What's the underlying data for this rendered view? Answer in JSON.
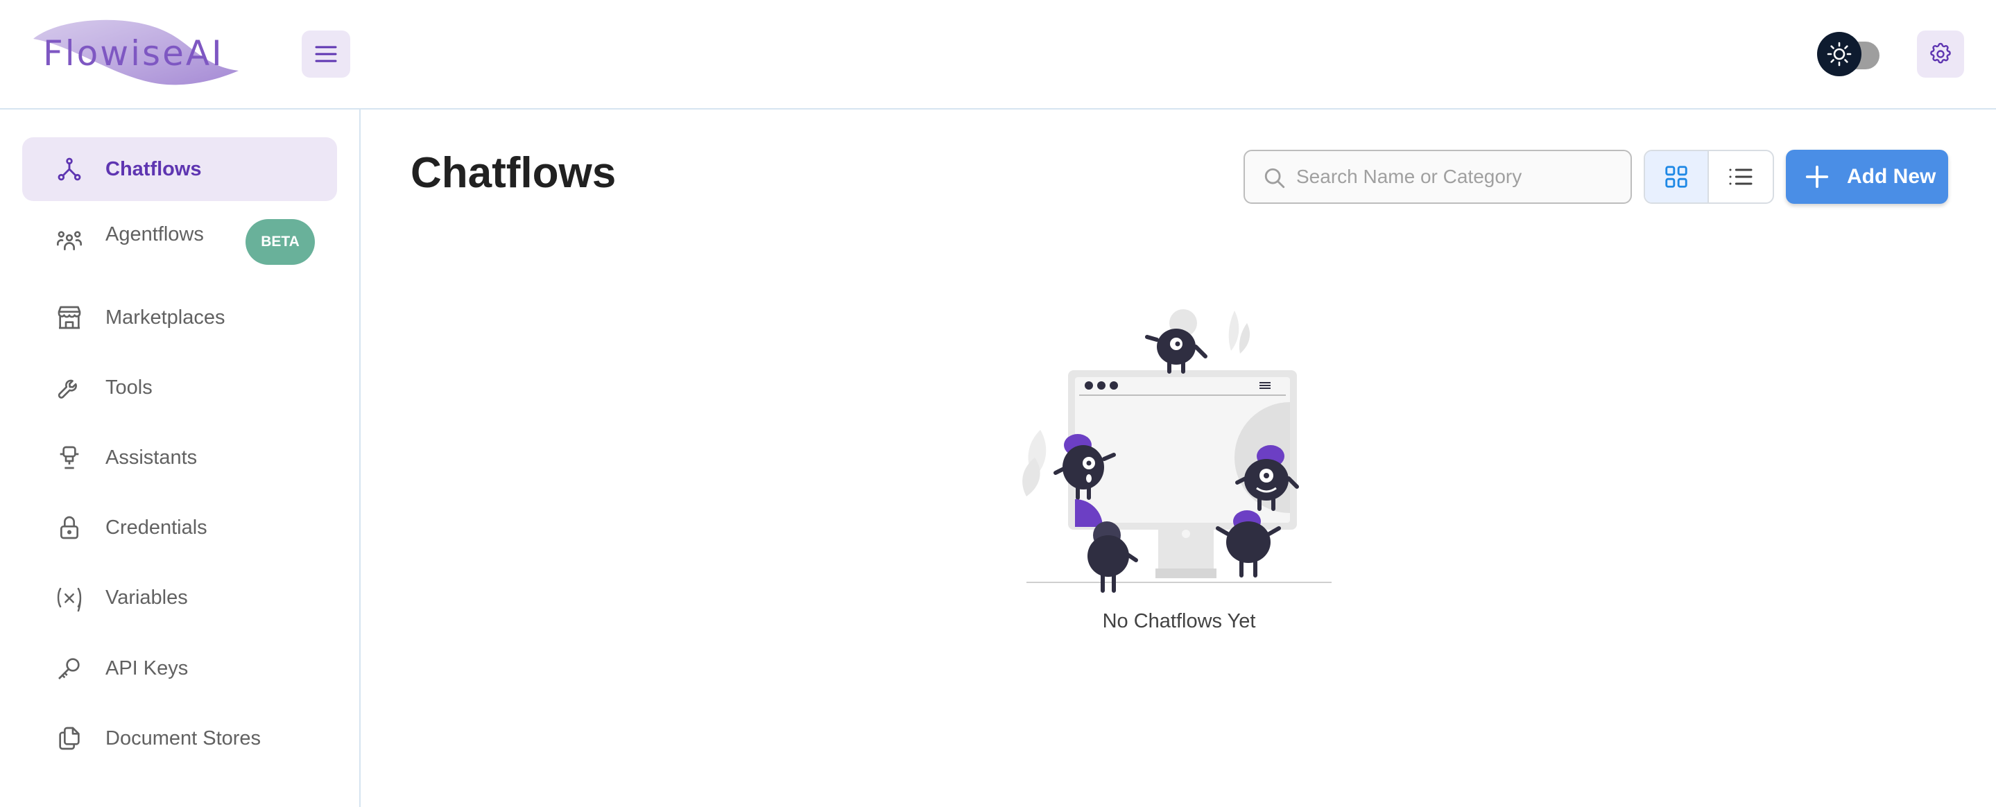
{
  "header": {
    "logo_text": "FlowiseAI",
    "colors": {
      "brand": "#7e57c2",
      "toggle_knob": "#0e1b2f",
      "icon_button_bg": "#ede7f6"
    },
    "icons": {
      "menu": "hamburger-icon",
      "theme": "sun-icon",
      "settings": "gear-icon"
    }
  },
  "sidebar": {
    "items": [
      {
        "label": "Chatflows",
        "icon": "chatflows-icon",
        "active": true
      },
      {
        "label": "Agentflows",
        "icon": "agentflows-icon",
        "badge": "BETA"
      },
      {
        "label": "Marketplaces",
        "icon": "store-icon"
      },
      {
        "label": "Tools",
        "icon": "wrench-icon"
      },
      {
        "label": "Assistants",
        "icon": "robot-icon"
      },
      {
        "label": "Credentials",
        "icon": "lock-icon"
      },
      {
        "label": "Variables",
        "icon": "variable-icon"
      },
      {
        "label": "API Keys",
        "icon": "key-icon"
      },
      {
        "label": "Document Stores",
        "icon": "files-icon"
      }
    ],
    "colors": {
      "active_bg": "#ede7f6",
      "active_text": "#5e35b1",
      "badge_bg": "#69b19a"
    }
  },
  "main": {
    "title": "Chatflows",
    "search": {
      "placeholder": "Search Name or Category",
      "value": ""
    },
    "view_toggle": {
      "selected": "grid",
      "options": [
        "grid",
        "list"
      ]
    },
    "add_button": {
      "label": "Add New",
      "color": "#4a8ee6"
    },
    "empty_state": {
      "message": "No Chatflows Yet"
    }
  }
}
